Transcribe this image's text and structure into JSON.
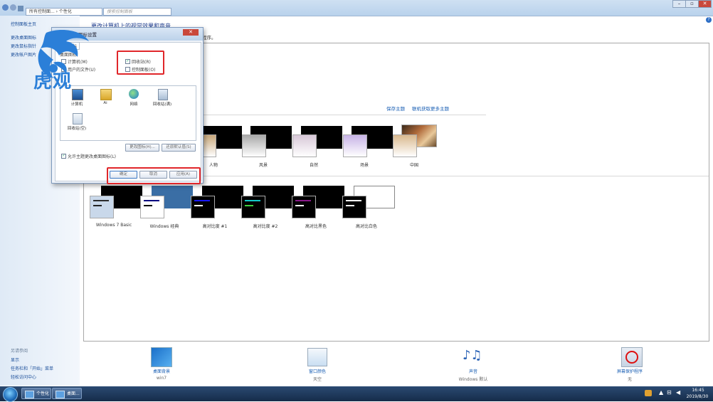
{
  "topbar": {
    "address": "所有控制面... › 个性化",
    "search_placeholder": "搜索控制面板",
    "help": "?",
    "minimize": "–",
    "maximize": "▫",
    "close": "✕"
  },
  "sidebar": {
    "home": "控制面板主页",
    "links": [
      "更改桌面图标",
      "更改鼠标指针",
      "更改帐户图片"
    ],
    "see_also_heading": "另请参阅",
    "see_also": [
      "显示",
      "任务栏和「开始」菜单",
      "轻松访问中心"
    ]
  },
  "main": {
    "heading": "更改计算机上的视觉效果和声音",
    "description": "程序。",
    "save_theme": "保存主题",
    "online_themes": "联机获取更多主题",
    "aero_themes": [
      {
        "label": "人物",
        "color": "#c8a77a"
      },
      {
        "label": "风景",
        "color": "#a9a9a9"
      },
      {
        "label": "自然",
        "color": "#d8c8d8"
      },
      {
        "label": "场景",
        "color": "#c7b3e6"
      },
      {
        "label": "中国",
        "color": "#d9b98e"
      }
    ],
    "basic_themes": [
      {
        "label": "Windows 7 Basic",
        "front": "#c9d8ea",
        "back": "#000000",
        "bar": "#2b2b2b"
      },
      {
        "label": "Windows 经典",
        "front": "#ffffff",
        "back": "#3a6ea5",
        "bar": "#000080"
      },
      {
        "label": "高对比度 #1",
        "front": "#000000",
        "back": "#000000",
        "bar": "#1818ff"
      },
      {
        "label": "高对比度 #2",
        "front": "#000000",
        "back": "#000000",
        "bar": "#13c9c9"
      },
      {
        "label": "高对比黑色",
        "front": "#000000",
        "back": "#000000",
        "bar": "#8a1a8a"
      },
      {
        "label": "高对比白色",
        "front": "#000000",
        "back": "#ffffff",
        "bar": "#ffffff"
      }
    ]
  },
  "bottom": [
    {
      "label": "桌面背景",
      "sub": "win7"
    },
    {
      "label": "窗口颜色",
      "sub": "天空"
    },
    {
      "label": "声音",
      "sub": "Windows 默认"
    },
    {
      "label": "屏幕保护程序",
      "sub": "无"
    }
  ],
  "dialog": {
    "title": "桌面图标设置",
    "close": "✕",
    "tab": "桌面图标",
    "section": "桌面图标",
    "checkboxes_left": [
      {
        "label": "计算机(M)",
        "checked": false
      },
      {
        "label": "用户的文件(U)",
        "checked": false
      }
    ],
    "checkboxes_right": [
      {
        "label": "回收站(R)",
        "checked": true
      },
      {
        "label": "控制面板(O)",
        "checked": false
      }
    ],
    "icons": [
      "计算机",
      "Ai",
      "网络",
      "回收站(满)",
      "回收站(空)"
    ],
    "change_icon": "更改图标(H)...",
    "restore_default": "还原默认值(S)",
    "allow_themes": "允许主题更改桌面图标(L)",
    "ok": "确定",
    "cancel": "取消",
    "apply": "应用(A)"
  },
  "watermark": {
    "text": "虎观"
  },
  "taskbar": {
    "buttons": [
      "个性化",
      "桌面..."
    ],
    "time": "16:45",
    "date": "2019/8/30"
  }
}
